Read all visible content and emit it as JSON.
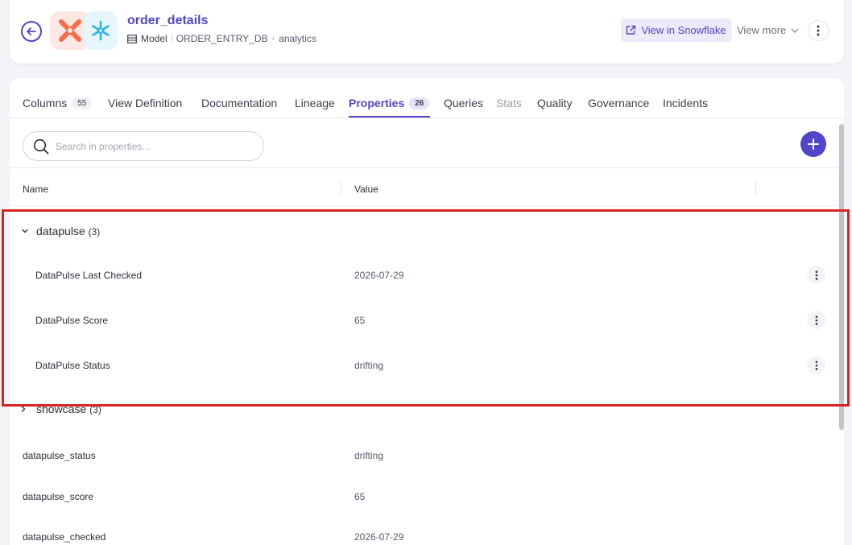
{
  "header": {
    "title": "order_details",
    "type_label": "Model",
    "database": "ORDER_ENTRY_DB",
    "schema": "analytics",
    "view_in_snowflake": "View in Snowflake",
    "view_more": "View more"
  },
  "tabs": [
    {
      "label": "Columns",
      "count": "55",
      "state": "normal"
    },
    {
      "label": "View Definition",
      "count": null,
      "state": "normal"
    },
    {
      "label": "Documentation",
      "count": null,
      "state": "normal"
    },
    {
      "label": "Lineage",
      "count": null,
      "state": "normal"
    },
    {
      "label": "Properties",
      "count": "26",
      "state": "active"
    },
    {
      "label": "Queries",
      "count": null,
      "state": "normal"
    },
    {
      "label": "Stats",
      "count": null,
      "state": "disabled"
    },
    {
      "label": "Quality",
      "count": null,
      "state": "normal"
    },
    {
      "label": "Governance",
      "count": null,
      "state": "normal"
    },
    {
      "label": "Incidents",
      "count": null,
      "state": "normal"
    }
  ],
  "search": {
    "placeholder": "Search in properties..."
  },
  "table": {
    "col_name": "Name",
    "col_value": "Value"
  },
  "groups": [
    {
      "name": "datapulse",
      "count": "(3)",
      "expanded": true,
      "rows": [
        {
          "name": "DataPulse Last Checked",
          "value": "2026-07-29"
        },
        {
          "name": "DataPulse Score",
          "value": "65"
        },
        {
          "name": "DataPulse Status",
          "value": "drifting"
        }
      ]
    },
    {
      "name": "showcase",
      "count": "(3)",
      "expanded": false,
      "rows": []
    }
  ],
  "loose_rows": [
    {
      "name": "datapulse_status",
      "value": "drifting"
    },
    {
      "name": "datapulse_score",
      "value": "65"
    },
    {
      "name": "datapulse_checked",
      "value": "2026-07-29"
    }
  ],
  "colors": {
    "accent": "#5046c8",
    "highlight": "#d62424",
    "dbt_orange": "#fe6a47",
    "snowflake_blue": "#29b5e8"
  },
  "icons": [
    "arrow-left-icon",
    "dbt-logo-icon",
    "snowflake-logo-icon",
    "table-icon",
    "external-link-icon",
    "chevron-down-icon",
    "kebab-icon",
    "search-icon",
    "plus-icon",
    "chevron-right-icon"
  ]
}
